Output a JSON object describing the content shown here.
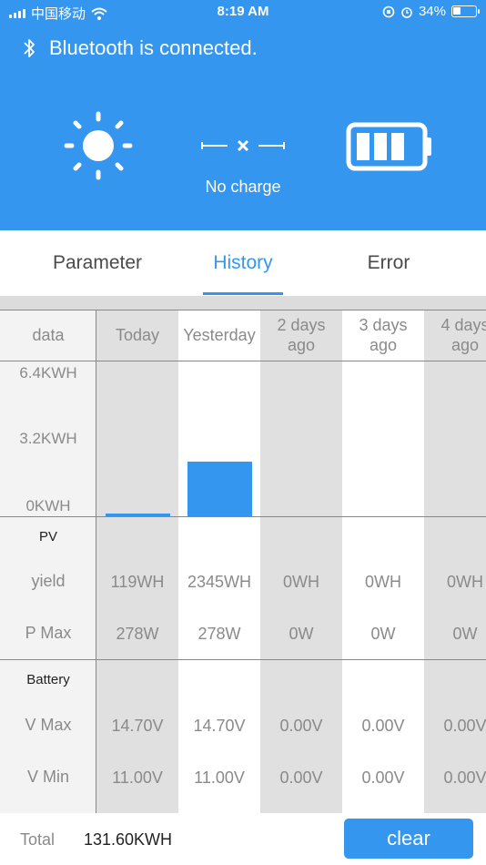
{
  "status_bar": {
    "carrier": "中国移动",
    "time": "8:19 AM",
    "battery_percent": "34%",
    "battery_level": 0.34
  },
  "header": {
    "bluetooth_text": "Bluetooth is connected.",
    "charge_status": "No charge",
    "colors": {
      "primary": "#3596ef",
      "shade": "#e0e0e0"
    }
  },
  "tabs": [
    {
      "label": "Parameter",
      "active": false
    },
    {
      "label": "History",
      "active": true
    },
    {
      "label": "Error",
      "active": false
    }
  ],
  "table": {
    "header_label": "data",
    "columns": [
      "Today",
      "Yesterday",
      "2 days ago",
      "3 days ago",
      "4 days ago"
    ],
    "axis": {
      "max": "6.4KWH",
      "mid": "3.2KWH",
      "min": "0KWH",
      "max_value": 6.4
    },
    "bar_values_kwh": [
      0.119,
      2.345,
      0,
      0,
      0
    ],
    "pv": {
      "title": "PV",
      "rows": [
        {
          "label": "yield",
          "values": [
            "119WH",
            "2345WH",
            "0WH",
            "0WH",
            "0WH"
          ]
        },
        {
          "label": "P Max",
          "values": [
            "278W",
            "278W",
            "0W",
            "0W",
            "0W"
          ]
        }
      ]
    },
    "battery": {
      "title": "Battery",
      "rows": [
        {
          "label": "V Max",
          "values": [
            "14.70V",
            "14.70V",
            "0.00V",
            "0.00V",
            "0.00V"
          ]
        },
        {
          "label": "V Min",
          "values": [
            "11.00V",
            "11.00V",
            "0.00V",
            "0.00V",
            "0.00V"
          ]
        }
      ]
    }
  },
  "footer": {
    "total_label": "Total",
    "total_value": "131.60KWH",
    "clear_label": "clear"
  }
}
